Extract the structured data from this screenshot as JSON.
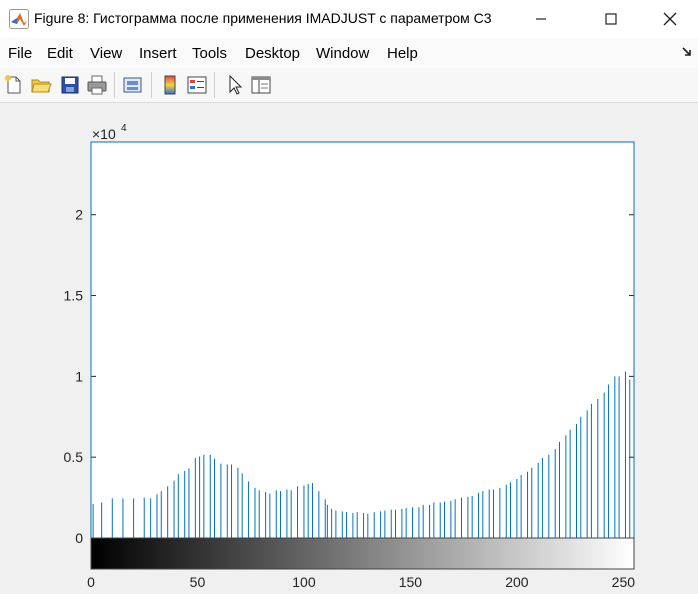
{
  "window": {
    "title": "Figure 8: Гистограмма после применения IMADJUST с параметром C3",
    "buttons": {
      "minimize": "minimize-icon",
      "maximize": "maximize-icon",
      "close": "close-icon"
    }
  },
  "menu": {
    "items": [
      "File",
      "Edit",
      "View",
      "Insert",
      "Tools",
      "Desktop",
      "Window",
      "Help"
    ]
  },
  "toolbar": {
    "icons": [
      "new-figure-icon",
      "open-file-icon",
      "save-icon",
      "print-icon",
      "print-preview-icon",
      "colorbar-icon",
      "legend-icon",
      "pointer-icon",
      "property-editor-icon"
    ]
  },
  "colors": {
    "stem": "#0072bd",
    "axis_box": "#0072bd"
  },
  "chart_data": {
    "type": "bar",
    "style": "stem-histogram",
    "exponent_label": "×10",
    "exponent_power": "4",
    "x_ticks": [
      "0",
      "50",
      "100",
      "150",
      "200",
      "250"
    ],
    "x_tick_values": [
      0,
      50,
      100,
      150,
      200,
      250
    ],
    "y_ticks": [
      "0",
      "0.5",
      "1",
      "1.5",
      "2"
    ],
    "y_tick_values": [
      0,
      5000,
      10000,
      15000,
      20000
    ],
    "xlim": [
      0,
      255
    ],
    "ylim": [
      0,
      24500
    ],
    "colorbar": "grayscale 0-255",
    "x": [
      1,
      5,
      10,
      15,
      20,
      25,
      28,
      31,
      33,
      36,
      39,
      41,
      44,
      46,
      49,
      51,
      53,
      56,
      58,
      61,
      64,
      66,
      69,
      71,
      74,
      77,
      79,
      82,
      84,
      87,
      89,
      92,
      94,
      97,
      100,
      102,
      104,
      107,
      110,
      111,
      113,
      115,
      118,
      120,
      123,
      125,
      128,
      130,
      133,
      136,
      138,
      141,
      143,
      146,
      148,
      151,
      154,
      156,
      159,
      161,
      164,
      166,
      169,
      171,
      174,
      177,
      179,
      182,
      184,
      187,
      189,
      192,
      195,
      197,
      200,
      202,
      205,
      207,
      210,
      212,
      215,
      218,
      220,
      223,
      225,
      228,
      230,
      233,
      235,
      238,
      241,
      243,
      246,
      248,
      251,
      253,
      255
    ],
    "values": [
      2100,
      2200,
      2450,
      2450,
      2450,
      2500,
      2450,
      2700,
      2900,
      3200,
      3550,
      3950,
      4150,
      4300,
      4950,
      5050,
      5150,
      5150,
      4900,
      4600,
      4550,
      4550,
      4350,
      4000,
      3500,
      3100,
      2950,
      2850,
      2750,
      2950,
      2900,
      3000,
      2950,
      3200,
      3250,
      3350,
      3400,
      2900,
      2400,
      2050,
      1800,
      1700,
      1650,
      1600,
      1550,
      1600,
      1550,
      1500,
      1600,
      1650,
      1700,
      1750,
      1750,
      1800,
      1850,
      1900,
      1900,
      2050,
      2050,
      2200,
      2200,
      2250,
      2300,
      2400,
      2500,
      2550,
      2600,
      2800,
      2900,
      3000,
      3000,
      3100,
      3300,
      3450,
      3650,
      3900,
      4100,
      4350,
      4650,
      4950,
      5150,
      5500,
      5950,
      6350,
      6700,
      7050,
      7500,
      7900,
      8300,
      8600,
      9000,
      9500,
      10000,
      10000,
      10300,
      9800,
      10200
    ]
  }
}
